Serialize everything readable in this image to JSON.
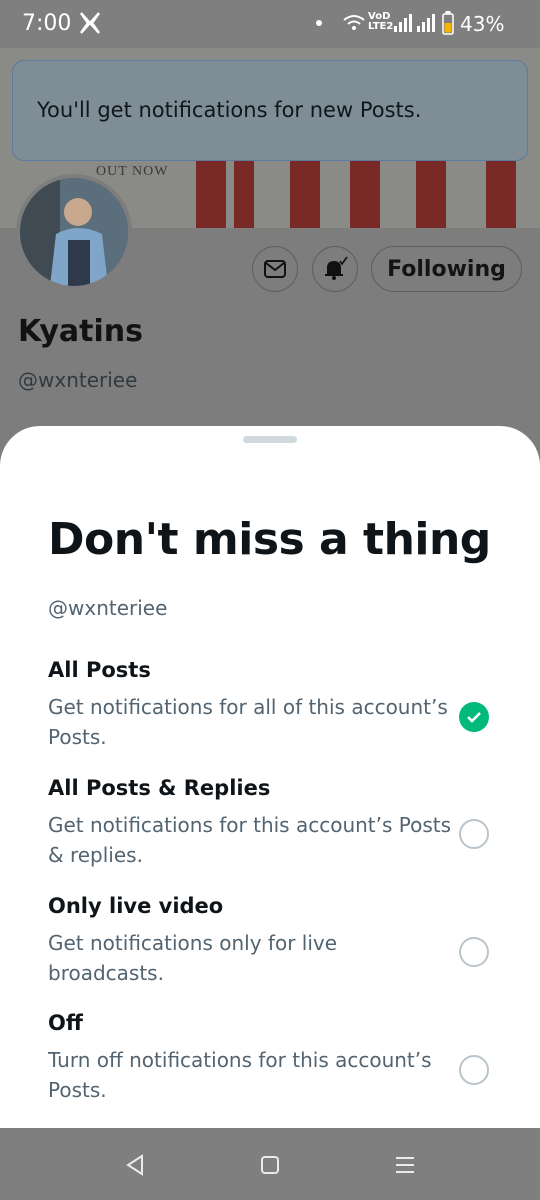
{
  "status_bar": {
    "time": "7:00",
    "network_label": "VoD LTE2",
    "battery_percent": "43%",
    "icons": [
      "x-logo-icon",
      "dot-icon",
      "wifi-icon",
      "signal-icon",
      "battery-icon"
    ]
  },
  "toast": {
    "message": "You'll get notifications for new Posts."
  },
  "profile": {
    "banner_text": "OUT NOW",
    "name": "Kyatins",
    "handle": "@wxnteriee",
    "following_label": "Following",
    "icons": [
      "message-icon",
      "notification-bell-icon"
    ]
  },
  "sheet": {
    "title": "Don't miss a thing",
    "handle": "@wxnteriee",
    "options": [
      {
        "label": "All Posts",
        "description": "Get notifications for all of this account’s Posts.",
        "selected": true
      },
      {
        "label": "All Posts & Replies",
        "description": "Get notifications for this account’s Posts & replies.",
        "selected": false
      },
      {
        "label": "Only live video",
        "description": "Get notifications only for live broadcasts.",
        "selected": false
      },
      {
        "label": "Off",
        "description": "Turn off notifications for this account’s Posts.",
        "selected": false
      }
    ]
  },
  "nav_bar": {
    "icons": [
      "back-icon",
      "home-icon",
      "recents-icon"
    ]
  },
  "colors": {
    "accent_green": "#00ba7c",
    "secondary_text": "#536471",
    "primary_text": "#0f1419"
  }
}
